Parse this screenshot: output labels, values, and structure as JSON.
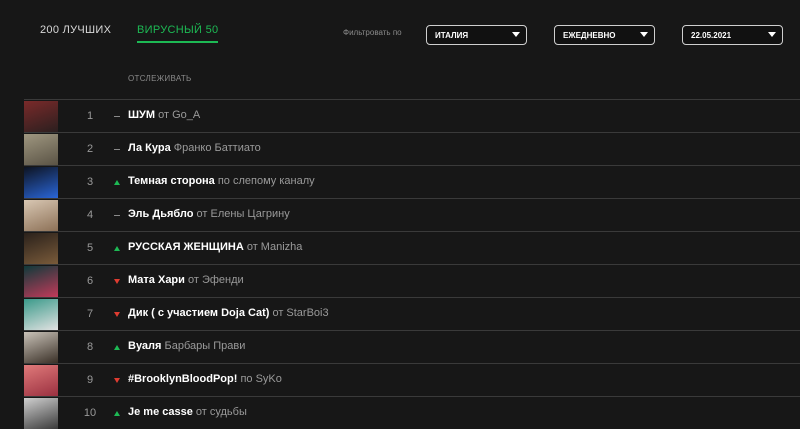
{
  "tabs": [
    {
      "label": "200 ЛУЧШИХ",
      "active": false
    },
    {
      "label": "ВИРУСНЫЙ 50",
      "active": true
    }
  ],
  "filter": {
    "label": "Фильтровать по",
    "country": "ИТАЛИЯ",
    "interval": "ЕЖЕДНЕВНО",
    "date": "22.05.2021"
  },
  "table": {
    "header_track": "ОТСЛЕЖИВАТЬ",
    "rows": [
      {
        "rank": "1",
        "trend": "same",
        "title": "ШУМ",
        "rest": " от Go_A",
        "art": [
          "#7a2a2a",
          "#2b1f1f"
        ]
      },
      {
        "rank": "2",
        "trend": "same",
        "title": "Ла Кура",
        "rest": " Франко Баттиато",
        "art": [
          "#9f9780",
          "#5a5345"
        ]
      },
      {
        "rank": "3",
        "trend": "up",
        "title": "Темная сторона",
        "rest": " по слепому каналу",
        "art": [
          "#0d1320",
          "#2a66d8"
        ]
      },
      {
        "rank": "4",
        "trend": "same",
        "title": "Эль Дьябло",
        "rest": " от Елены Цагрину",
        "art": [
          "#d8c7b3",
          "#8d7157"
        ]
      },
      {
        "rank": "5",
        "trend": "up",
        "title": "РУССКАЯ ЖЕНЩИНА",
        "rest": " от Manizha",
        "art": [
          "#2a211b",
          "#7a5b3a"
        ]
      },
      {
        "rank": "6",
        "trend": "down",
        "title": "Мата Хари",
        "rest": " от Эфенди",
        "art": [
          "#0f3a3a",
          "#c23a5a"
        ]
      },
      {
        "rank": "7",
        "trend": "down",
        "title": "Дик ( с участием Doja Cat)",
        "rest": " от StarBoi3",
        "art": [
          "#3a9a8a",
          "#e2e2e2"
        ]
      },
      {
        "rank": "8",
        "trend": "up",
        "title": "Вуаля",
        "rest": " Барбары Прави",
        "art": [
          "#c9c2b8",
          "#3a3027"
        ]
      },
      {
        "rank": "9",
        "trend": "down",
        "title": "#BrooklynBloodPop!",
        "rest": " по SyKo",
        "art": [
          "#e07a7a",
          "#9a3040"
        ]
      },
      {
        "rank": "10",
        "trend": "up",
        "title": "Je me casse",
        "rest": " от судьбы",
        "art": [
          "#d0d0d0",
          "#3a3a3a"
        ]
      }
    ]
  }
}
